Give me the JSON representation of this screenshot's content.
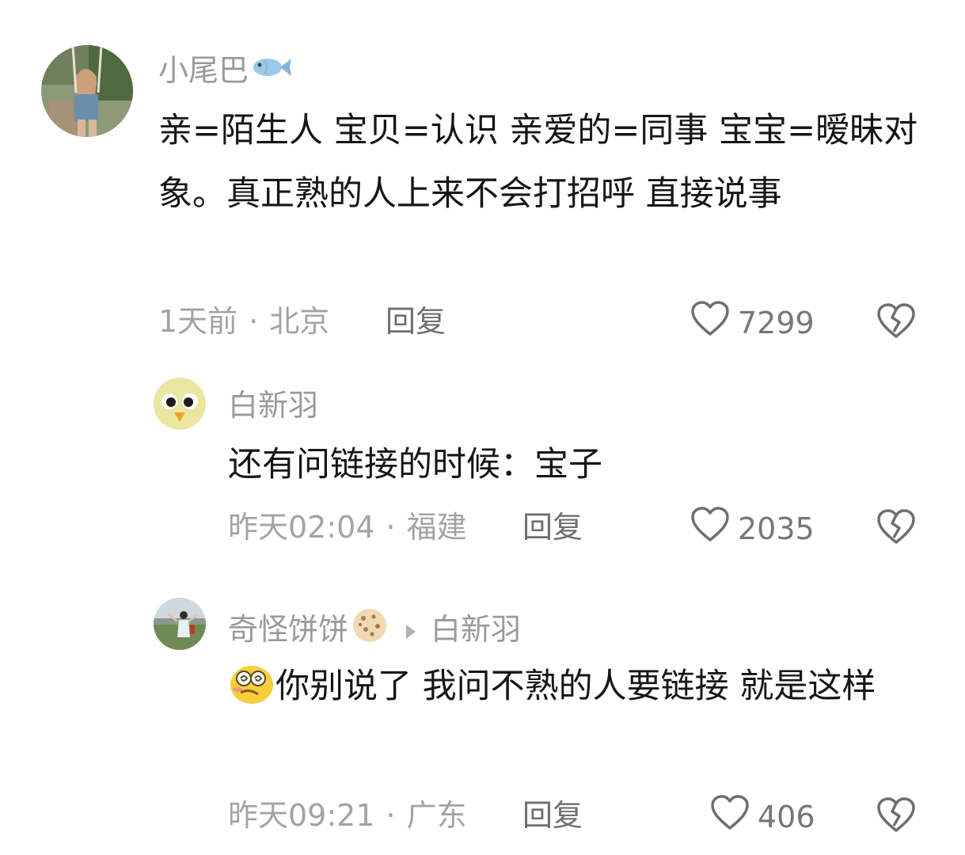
{
  "comments": [
    {
      "author": "小尾巴",
      "author_emoji": "fish-icon",
      "text": "亲=陌生人 宝贝=认识 亲爱的=同事 宝宝=暧昧对象。真正熟的人上来不会打招呼 直接说事",
      "time": "1天前",
      "location": "北京",
      "reply_label": "回复",
      "likes": "7299"
    },
    {
      "author": "白新羽",
      "text": "还有问链接的时候：宝子",
      "time": "昨天02:04",
      "location": "福建",
      "reply_label": "回复",
      "likes": "2035"
    },
    {
      "author": "奇怪饼饼",
      "author_emoji": "cookie-icon",
      "reply_to": "白新羽",
      "text": "你别说了 我问不熟的人要链接 就是这样",
      "text_emoji": "dizzy-face-icon",
      "time": "昨天09:21",
      "location": "广东",
      "reply_label": "回复",
      "likes": "406"
    }
  ],
  "separator": "·"
}
